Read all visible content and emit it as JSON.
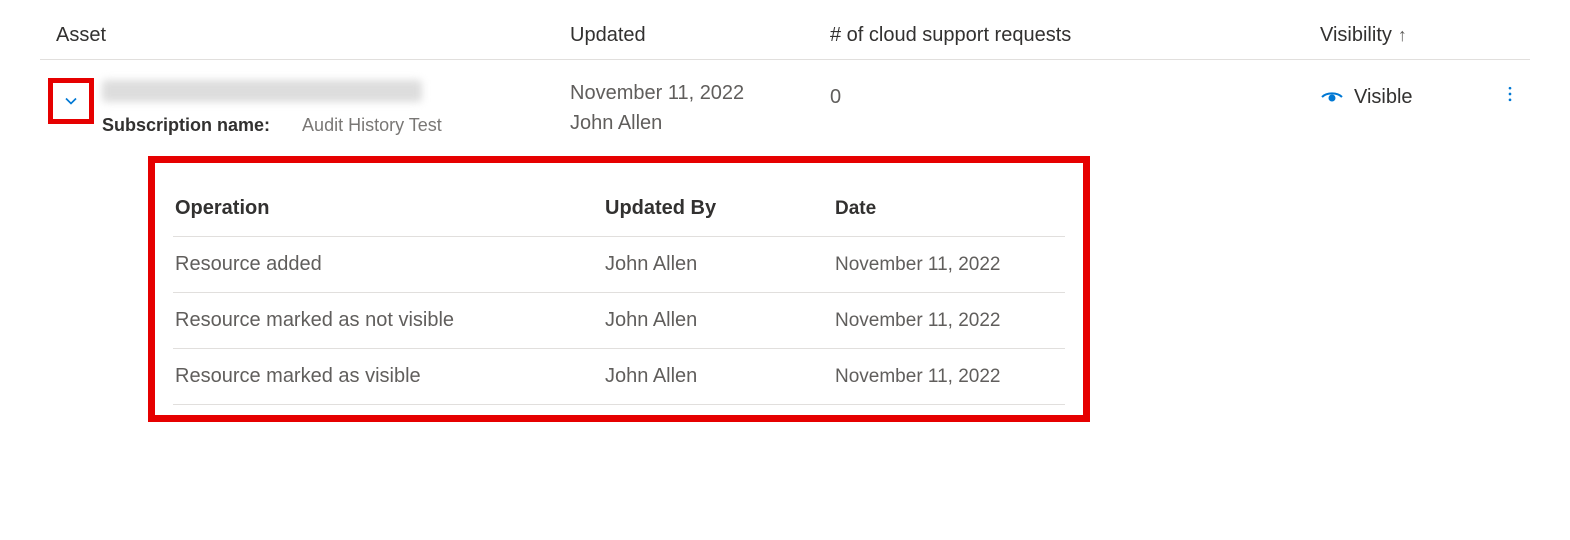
{
  "table": {
    "headers": {
      "asset": "Asset",
      "updated": "Updated",
      "csr": "# of cloud support requests",
      "visibility": "Visibility",
      "sort_indicator": "↑"
    },
    "row": {
      "asset_id_redacted": "████████████",
      "sub_label": "Subscription name:",
      "sub_value": "Audit History Test",
      "updated_date": "November 11, 2022",
      "updated_by": "John Allen",
      "csr_count": "0",
      "visibility_label": "Visible"
    }
  },
  "history": {
    "headers": {
      "operation": "Operation",
      "updated_by": "Updated By",
      "date": "Date"
    },
    "rows": [
      {
        "operation": "Resource added",
        "by": "John Allen",
        "date": "November 11, 2022"
      },
      {
        "operation": "Resource marked as not visible",
        "by": "John Allen",
        "date": "November 11, 2022"
      },
      {
        "operation": "Resource marked as visible",
        "by": "John Allen",
        "date": "November 11, 2022"
      }
    ]
  }
}
